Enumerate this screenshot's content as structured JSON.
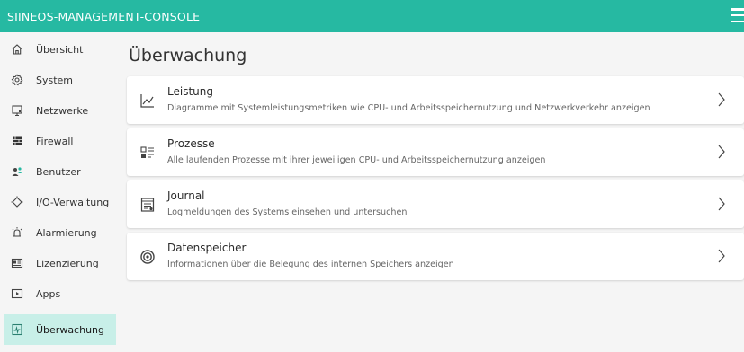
{
  "app": {
    "title": "SIINEOS-MANAGEMENT-CONSOLE",
    "menu_icon": "hamburger-menu-icon"
  },
  "sidebar": {
    "items": [
      {
        "label": "Übersicht",
        "icon": "home-icon"
      },
      {
        "label": "System",
        "icon": "gear-icon"
      },
      {
        "label": "Netzwerke",
        "icon": "monitor-icon"
      },
      {
        "label": "Firewall",
        "icon": "firewall-icon"
      },
      {
        "label": "Benutzer",
        "icon": "users-icon"
      },
      {
        "label": "I/O-Verwaltung",
        "icon": "io-icon"
      },
      {
        "label": "Alarmierung",
        "icon": "alarm-icon"
      },
      {
        "label": "Lizenzierung",
        "icon": "license-icon"
      },
      {
        "label": "Apps",
        "icon": "apps-icon"
      },
      {
        "label": "Überwachung",
        "icon": "monitoring-icon",
        "active": true
      }
    ]
  },
  "main": {
    "title": "Überwachung",
    "cards": [
      {
        "title": "Leistung",
        "description": "Diagramme mit Systemleistungsmetriken wie CPU- und Arbeitsspeichernutzung und Netzwerkverkehr anzeigen",
        "icon": "line-chart-icon"
      },
      {
        "title": "Prozesse",
        "description": "Alle laufenden Prozesse mit ihrer jeweiligen CPU- und Arbeitsspeichernutzung anzeigen",
        "icon": "processes-icon"
      },
      {
        "title": "Journal",
        "description": "Logmeldungen des Systems einsehen und untersuchen",
        "icon": "journal-icon"
      },
      {
        "title": "Datenspeicher",
        "description": "Informationen über die Belegung des internen Speichers anzeigen",
        "icon": "storage-icon"
      }
    ]
  },
  "colors": {
    "header": "#26b9a2",
    "active_item": "#c8efe8",
    "background": "#f5f5f5"
  }
}
